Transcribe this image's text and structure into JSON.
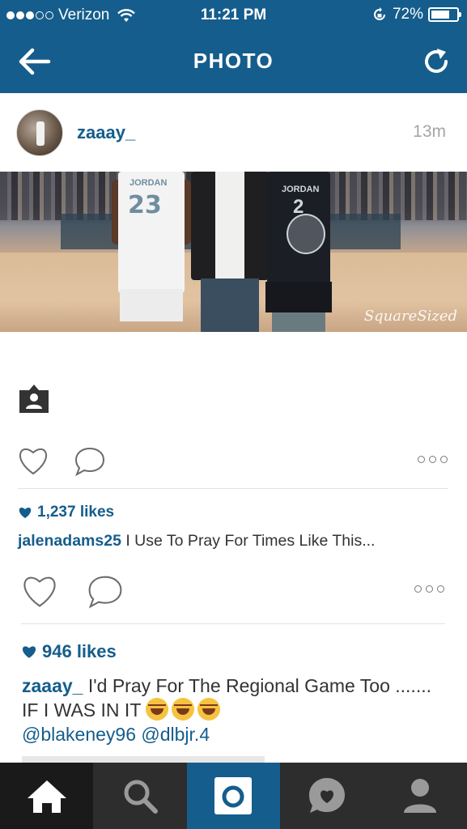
{
  "status_bar": {
    "carrier": "Verizon",
    "time": "11:21 PM",
    "battery_percent": "72%",
    "battery_level": 0.72,
    "signal_bars_filled": 3,
    "signal_bars_total": 5
  },
  "nav": {
    "title": "PHOTO",
    "back_icon": "back-arrow-icon",
    "refresh_icon": "refresh-icon"
  },
  "post": {
    "username": "zaaay_",
    "time_ago": "13m",
    "photo_watermark": "SquareSized",
    "photo_jersey_1_name": "JORDAN",
    "photo_jersey_1_number": "23",
    "photo_jersey_2_name": "JORDAN",
    "photo_jersey_2_number": "2"
  },
  "entries": [
    {
      "likes": "1,237 likes",
      "caption_user": "jalenadams25",
      "caption_text": "I Use To Pray For Times Like This..."
    },
    {
      "likes": "946 likes",
      "caption_user": "zaaay_",
      "caption_text": "I'd Pray For The Regional Game Too ....... IF I WAS IN IT",
      "mention_1": "@blakeney96",
      "mention_2": "@dlbjr.4"
    }
  ],
  "tabs": [
    {
      "name": "home",
      "icon": "home-icon"
    },
    {
      "name": "search",
      "icon": "search-icon"
    },
    {
      "name": "camera",
      "icon": "camera-icon"
    },
    {
      "name": "activity",
      "icon": "heart-bubble-icon"
    },
    {
      "name": "profile",
      "icon": "profile-icon"
    }
  ],
  "colors": {
    "brand_blue": "#155d8c",
    "tabbar_bg": "#2d2d2d"
  }
}
